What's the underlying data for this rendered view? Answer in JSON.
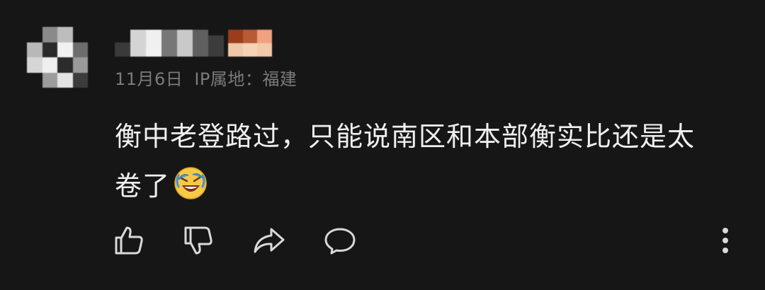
{
  "comment": {
    "meta": {
      "date": "11月6日",
      "ip_location": "IP属地：福建"
    },
    "content": {
      "line1": "衡中老登路过，只能说南区和本部衡实比还是太",
      "line2": "卷了"
    },
    "emoji": "laughing-crying-face-icon",
    "actions": {
      "like": "thumbs-up-icon",
      "dislike": "thumbs-down-icon",
      "share": "share-arrow-icon",
      "reply": "comment-bubble-icon",
      "more": "more-vertical-icon"
    }
  },
  "colors": {
    "background": "#161616",
    "text": "#efefef",
    "meta_text": "#7b7b7b",
    "icon": "#d9d9d9"
  }
}
